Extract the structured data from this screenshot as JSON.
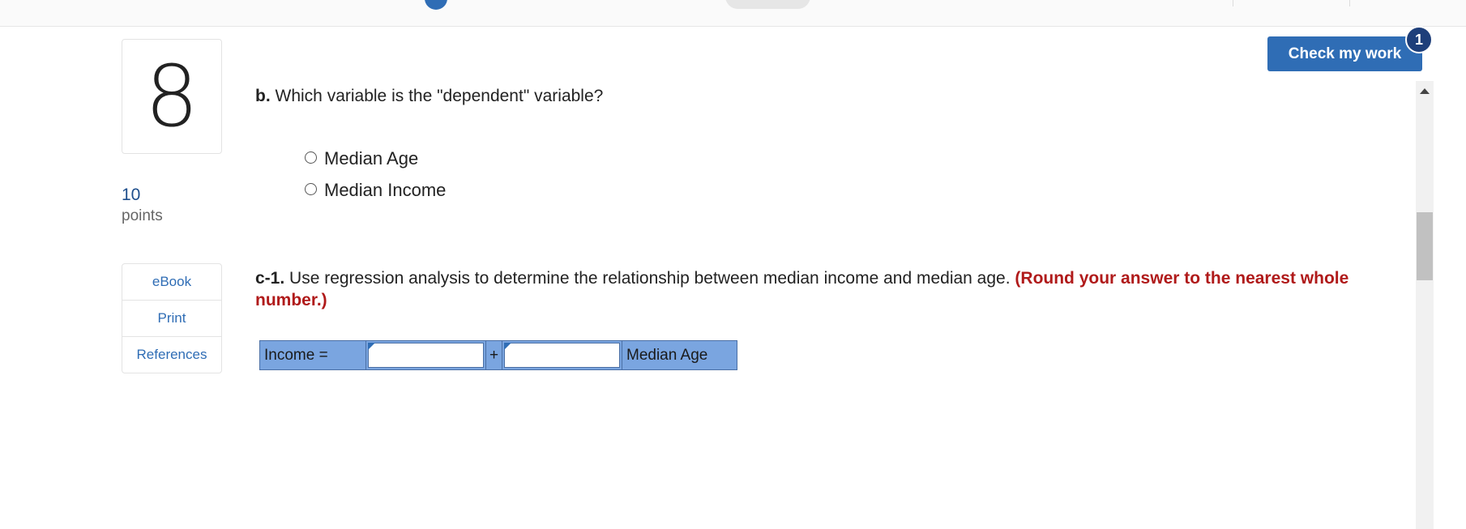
{
  "question": {
    "number": "8",
    "points_value": "10",
    "points_label": "points"
  },
  "side_nav": {
    "items": [
      {
        "label": "eBook"
      },
      {
        "label": "Print"
      },
      {
        "label": "References"
      }
    ]
  },
  "part_b": {
    "prefix": "b.",
    "text": "Which variable is the \"dependent\" variable?",
    "options": [
      {
        "label": "Median Age"
      },
      {
        "label": "Median Income"
      }
    ]
  },
  "part_c1": {
    "prefix": "c-1.",
    "text": "Use regression analysis to determine the relationship between median income and median age.",
    "note": "(Round your answer to the nearest whole number.)"
  },
  "equation": {
    "label": "Income =",
    "operator": "+",
    "tail": "Median Age",
    "intercept_value": "",
    "slope_value": ""
  },
  "check_button": {
    "label": "Check my work",
    "badge_count": "1"
  },
  "colors": {
    "primary": "#2f6db5",
    "badge": "#1e3f7a",
    "note_red": "#b01a1a",
    "equation_bg": "#7aa5e0"
  }
}
